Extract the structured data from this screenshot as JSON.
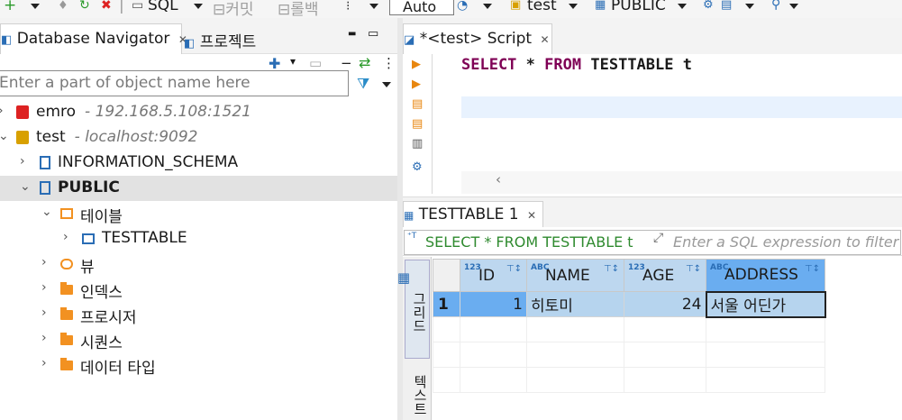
{
  "toolbar": {
    "sql_label": "SQL",
    "commit_label": "커밋",
    "rollback_label": "롤백",
    "mode_value": "Auto",
    "datasource": "test",
    "schema": "PUBLIC"
  },
  "navigator": {
    "tab_label": "Database Navigator",
    "project_tab_label": "프로젝트",
    "filter_placeholder": "Enter a part of object name here",
    "tree": [
      {
        "name": "emro",
        "detail": "- 192.168.5.108:1521"
      },
      {
        "name": "test",
        "detail": "- localhost:9092"
      },
      {
        "name": "INFORMATION_SCHEMA"
      },
      {
        "name": "PUBLIC"
      },
      {
        "name": "테이블"
      },
      {
        "name": "TESTTABLE"
      },
      {
        "name": "뷰"
      },
      {
        "name": "인덱스"
      },
      {
        "name": "프로시저"
      },
      {
        "name": "시퀀스"
      },
      {
        "name": "데이터 타입"
      }
    ]
  },
  "editor": {
    "tab_label": "*<test> Script",
    "sql": {
      "kw1": "SELECT",
      "star": "*",
      "kw2": "FROM",
      "rest": "TESTTABLE t"
    }
  },
  "results": {
    "tab_label": "TESTTABLE 1",
    "query_text": "SELECT * FROM TESTTABLE t",
    "filter_placeholder": "Enter a SQL expression to filter",
    "vertical_tabs": [
      "그리드",
      "텍스트"
    ],
    "columns": [
      {
        "name": "ID",
        "type": "123"
      },
      {
        "name": "NAME",
        "type": "ABC"
      },
      {
        "name": "AGE",
        "type": "123"
      },
      {
        "name": "ADDRESS",
        "type": "ABC"
      }
    ],
    "rows": [
      {
        "num": "1",
        "id": "1",
        "name": "히토미",
        "age": "24",
        "address": "서울 어딘가"
      }
    ]
  }
}
